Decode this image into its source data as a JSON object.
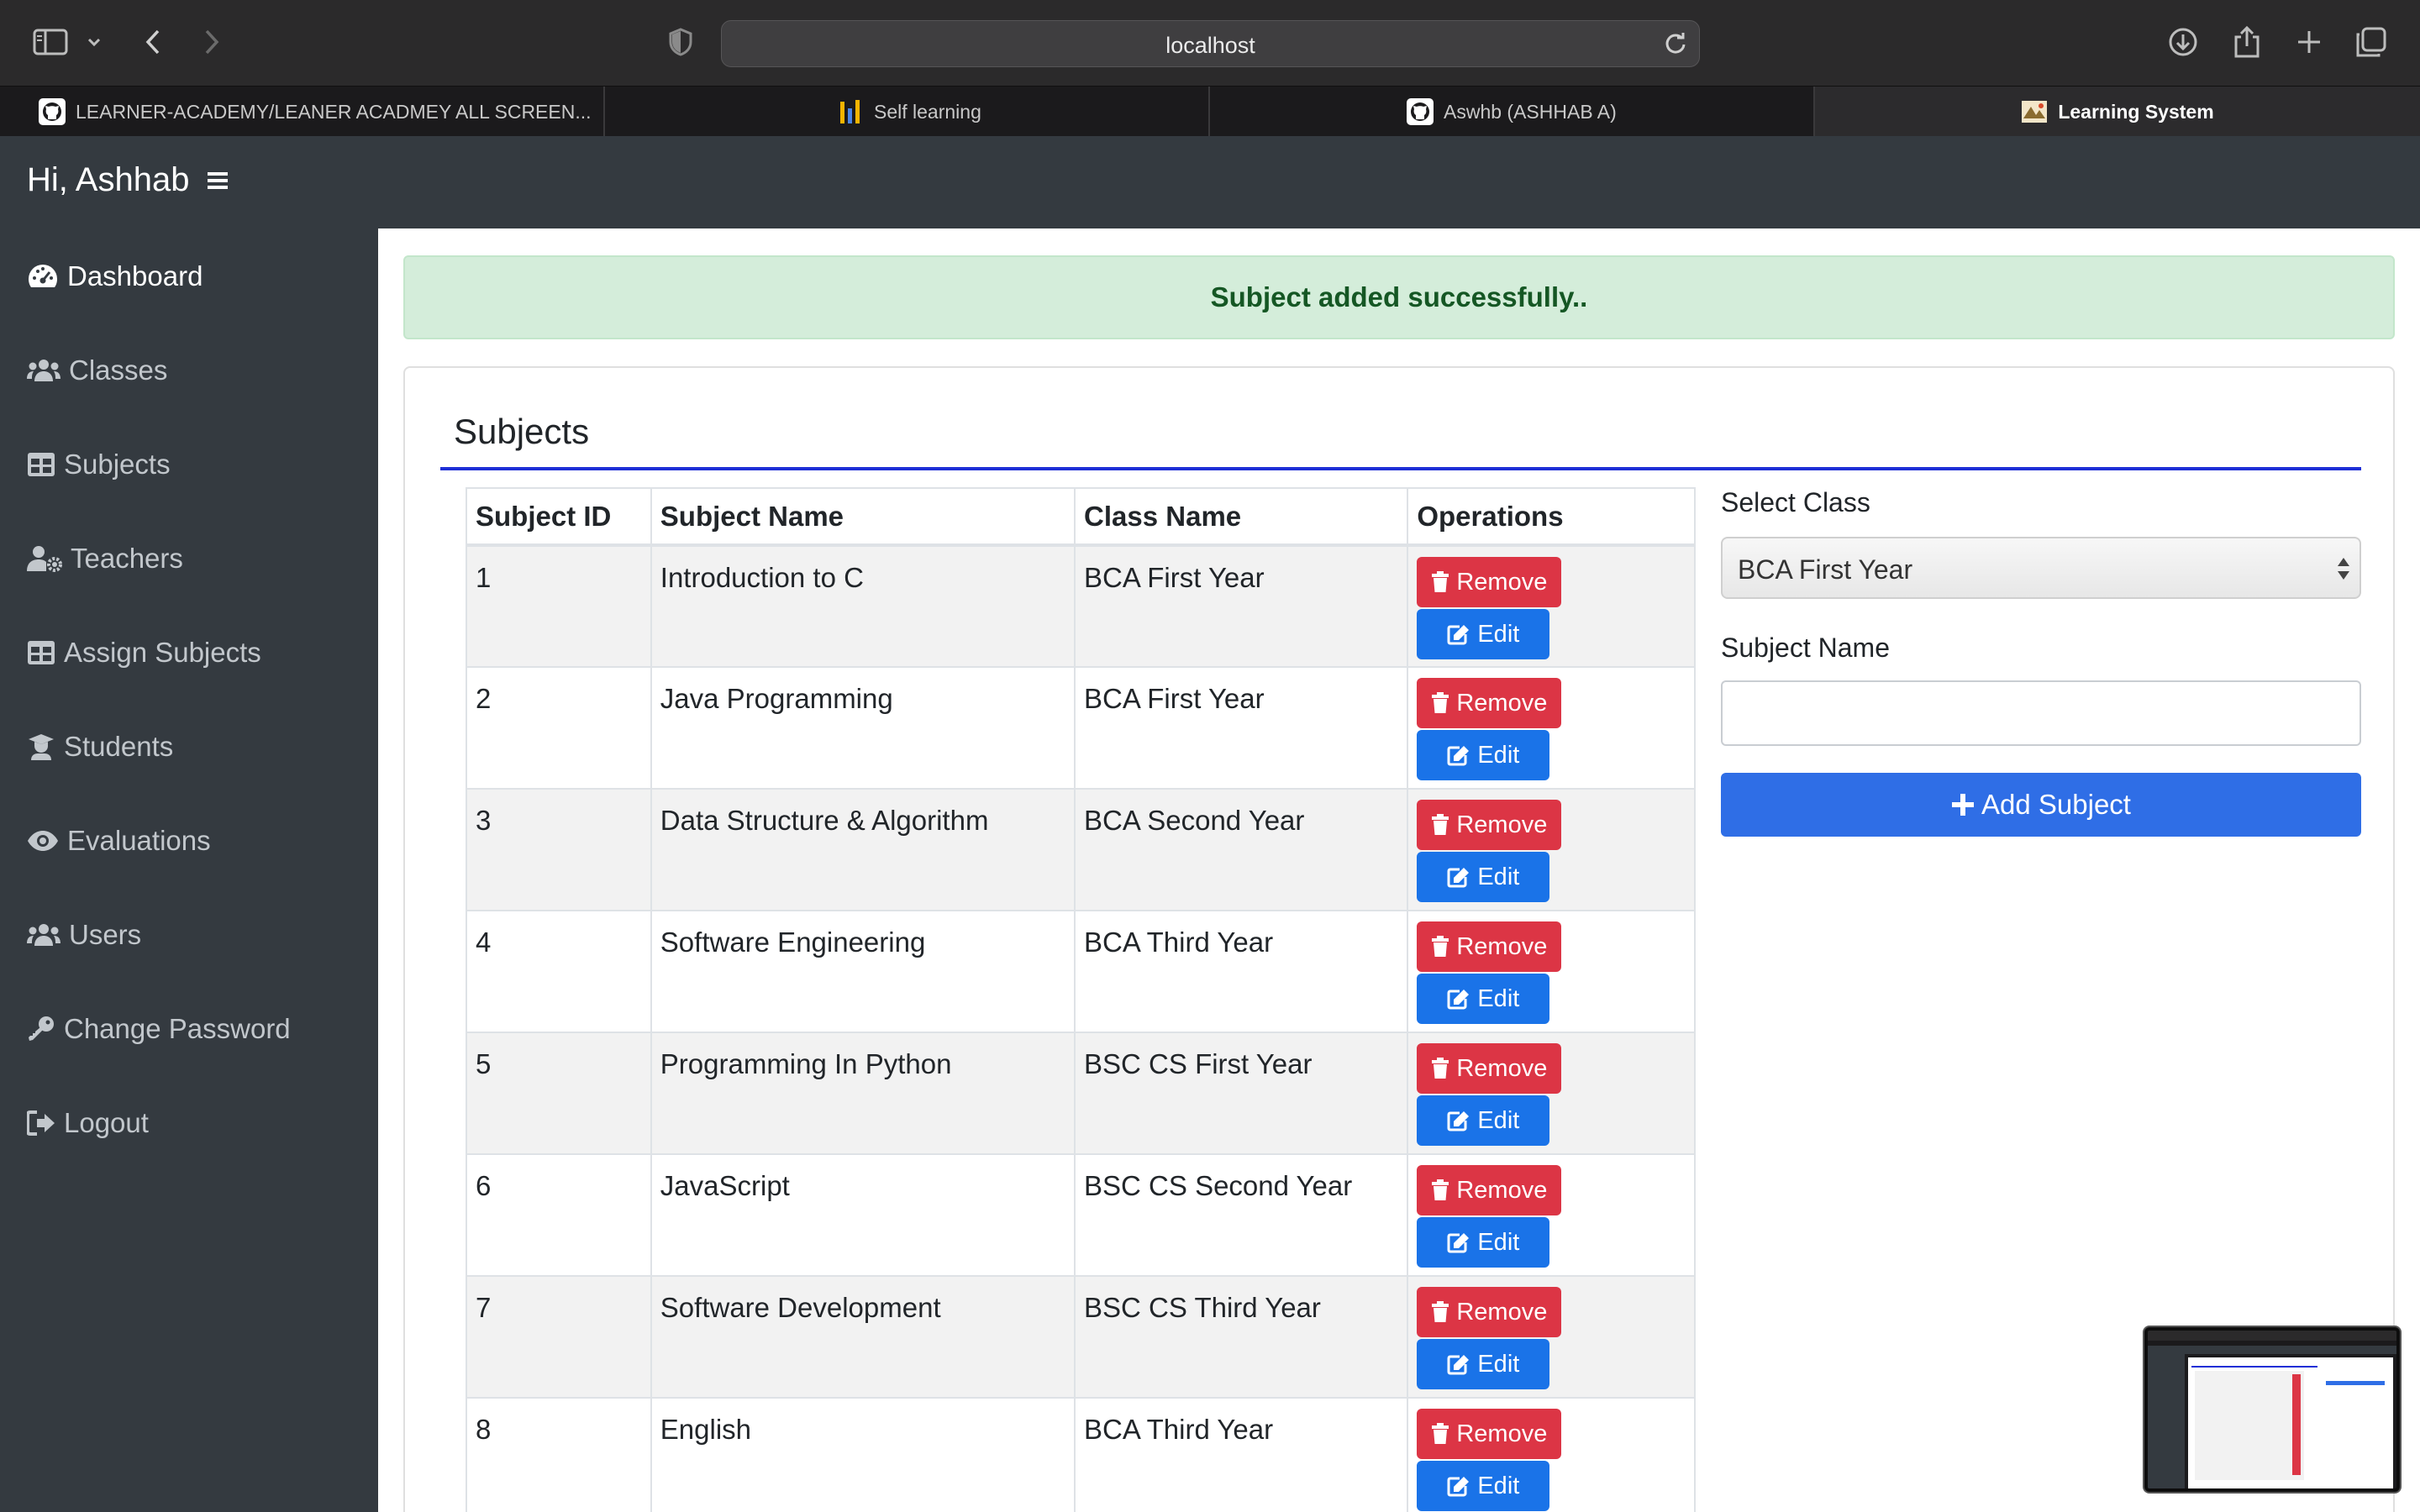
{
  "browser": {
    "url": "localhost",
    "tabs": [
      {
        "title": "LEARNER-ACADEMY/LEANER ACADMEY ALL SCREEN...",
        "icon": "github-icon"
      },
      {
        "title": "Self learning",
        "icon": "chart-icon"
      },
      {
        "title": "Aswhb (ASHHAB A)",
        "icon": "github-icon"
      },
      {
        "title": "Learning System",
        "icon": "app-logo-icon"
      }
    ]
  },
  "header": {
    "greeting": "Hi, Ashhab"
  },
  "sidebar": {
    "items": [
      {
        "label": "Dashboard",
        "icon": "tachometer-icon"
      },
      {
        "label": "Classes",
        "icon": "users-icon"
      },
      {
        "label": "Subjects",
        "icon": "table-icon"
      },
      {
        "label": "Teachers",
        "icon": "user-cog-icon"
      },
      {
        "label": "Assign Subjects",
        "icon": "table-icon"
      },
      {
        "label": "Students",
        "icon": "graduate-icon"
      },
      {
        "label": "Evaluations",
        "icon": "eye-icon"
      },
      {
        "label": "Users",
        "icon": "users-icon"
      },
      {
        "label": "Change Password",
        "icon": "key-icon"
      },
      {
        "label": "Logout",
        "icon": "sign-out-icon"
      }
    ]
  },
  "alert": {
    "message": "Subject added successfully.."
  },
  "card": {
    "title": "Subjects"
  },
  "table": {
    "columns": [
      "Subject ID",
      "Subject Name",
      "Class Name",
      "Operations"
    ],
    "remove_label": "Remove",
    "edit_label": "Edit",
    "rows": [
      {
        "id": "1",
        "name": "Introduction to C",
        "class": "BCA First Year"
      },
      {
        "id": "2",
        "name": "Java Programming",
        "class": "BCA First Year"
      },
      {
        "id": "3",
        "name": "Data Structure & Algorithm",
        "class": "BCA Second Year"
      },
      {
        "id": "4",
        "name": "Software Engineering",
        "class": "BCA Third Year"
      },
      {
        "id": "5",
        "name": "Programming In Python",
        "class": "BSC CS First Year"
      },
      {
        "id": "6",
        "name": "JavaScript",
        "class": "BSC CS Second Year"
      },
      {
        "id": "7",
        "name": "Software Development",
        "class": "BSC CS Third Year"
      },
      {
        "id": "8",
        "name": "English",
        "class": "BCA Third Year"
      }
    ]
  },
  "form": {
    "select_class_label": "Select Class",
    "selected_class": "BCA First Year",
    "subject_name_label": "Subject Name",
    "subject_name_value": "",
    "add_button": "Add Subject"
  },
  "colors": {
    "sidebar_bg": "#343a40",
    "alert_bg": "#d4edda",
    "alert_text": "#155724",
    "remove_btn": "#dc3545",
    "edit_btn": "#1a73e8",
    "add_btn": "#2f6ee6",
    "title_rule": "#1e2fd6"
  }
}
